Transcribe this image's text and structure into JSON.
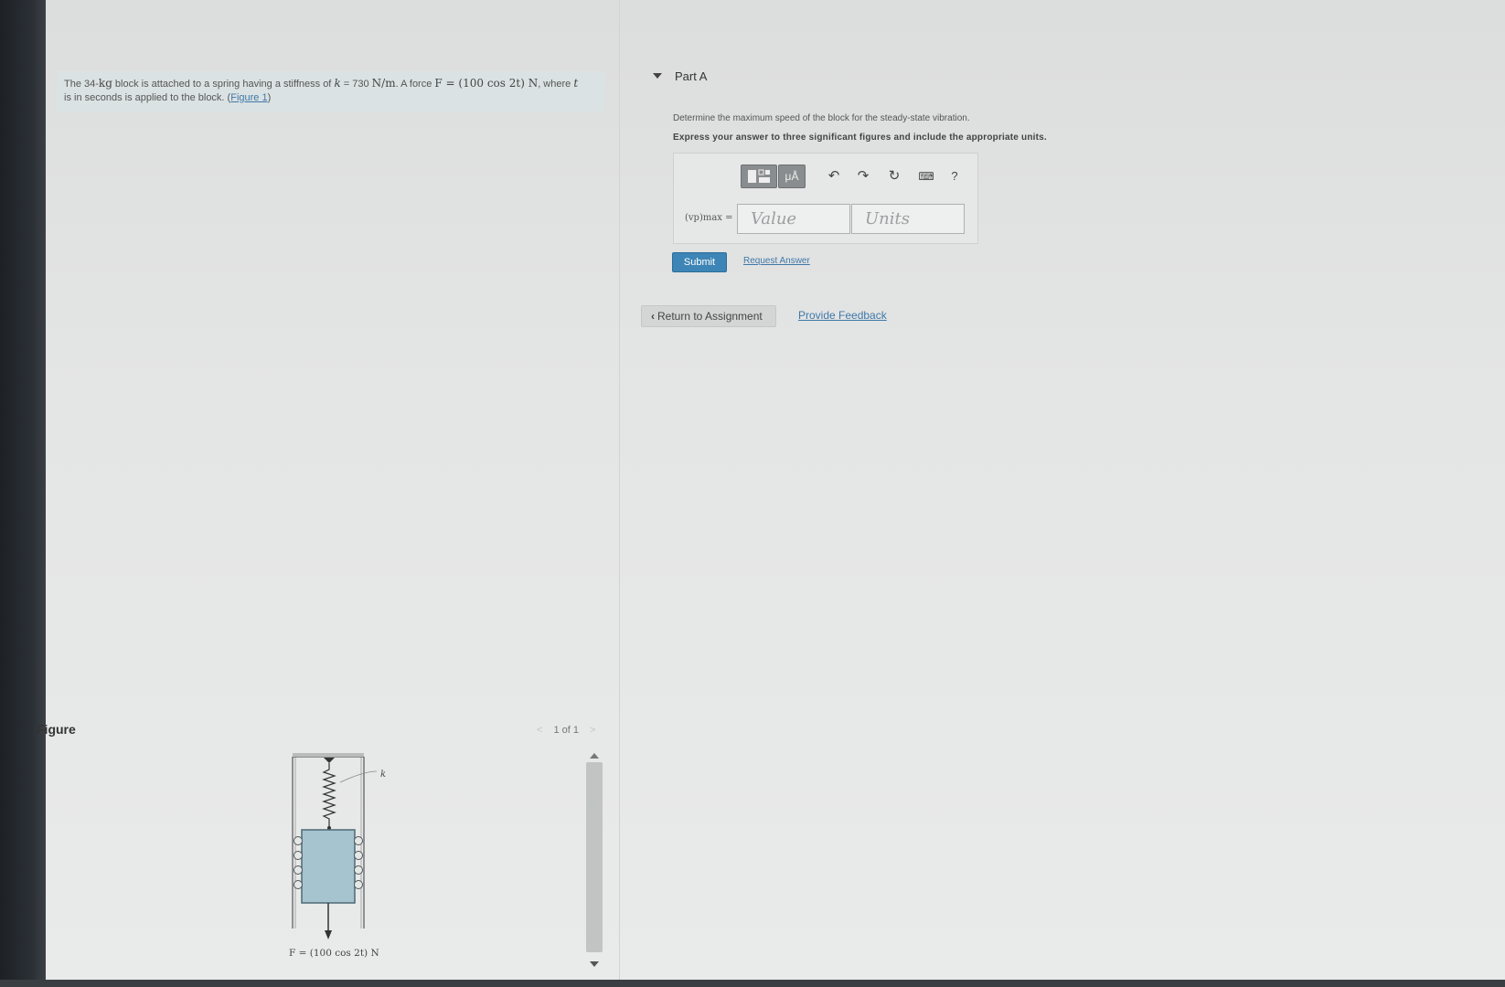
{
  "problem": {
    "text_1": "The 34-",
    "kg": "kg",
    "text_2": " block is attached to a spring having a stiffness of ",
    "k_expr": "k",
    "k_value": " = 730 ",
    "k_units": "N/m",
    "text_3": ". A force ",
    "f_expr": "F = (100 cos 2t) N",
    "text_4": ", where ",
    "t_var": "t",
    "text_5": "is in seconds is applied to the block. (",
    "figure_link": "Figure 1",
    "text_6": ")"
  },
  "figure": {
    "label": "Figure",
    "pager_prev": "<",
    "pager_text": "1 of 1",
    "pager_next": ">",
    "spring_label": "k",
    "force_label": "F = (100 cos 2t) N"
  },
  "part": {
    "title": "Part A",
    "question": "Determine the maximum speed of the block for the steady-state vibration.",
    "instruction": "Express your answer to three significant figures and include the appropriate units.",
    "answer_label": "(vp)max =",
    "value_placeholder": "Value",
    "units_placeholder": "Units",
    "units_button": "μÅ",
    "help": "?"
  },
  "actions": {
    "submit": "Submit",
    "request_answer": "Request Answer",
    "return": "Return to Assignment",
    "feedback": "Provide Feedback"
  },
  "colors": {
    "link": "#3f78a8",
    "submit_bg": "#3d85b6",
    "block_fill": "#a5c4cf"
  }
}
